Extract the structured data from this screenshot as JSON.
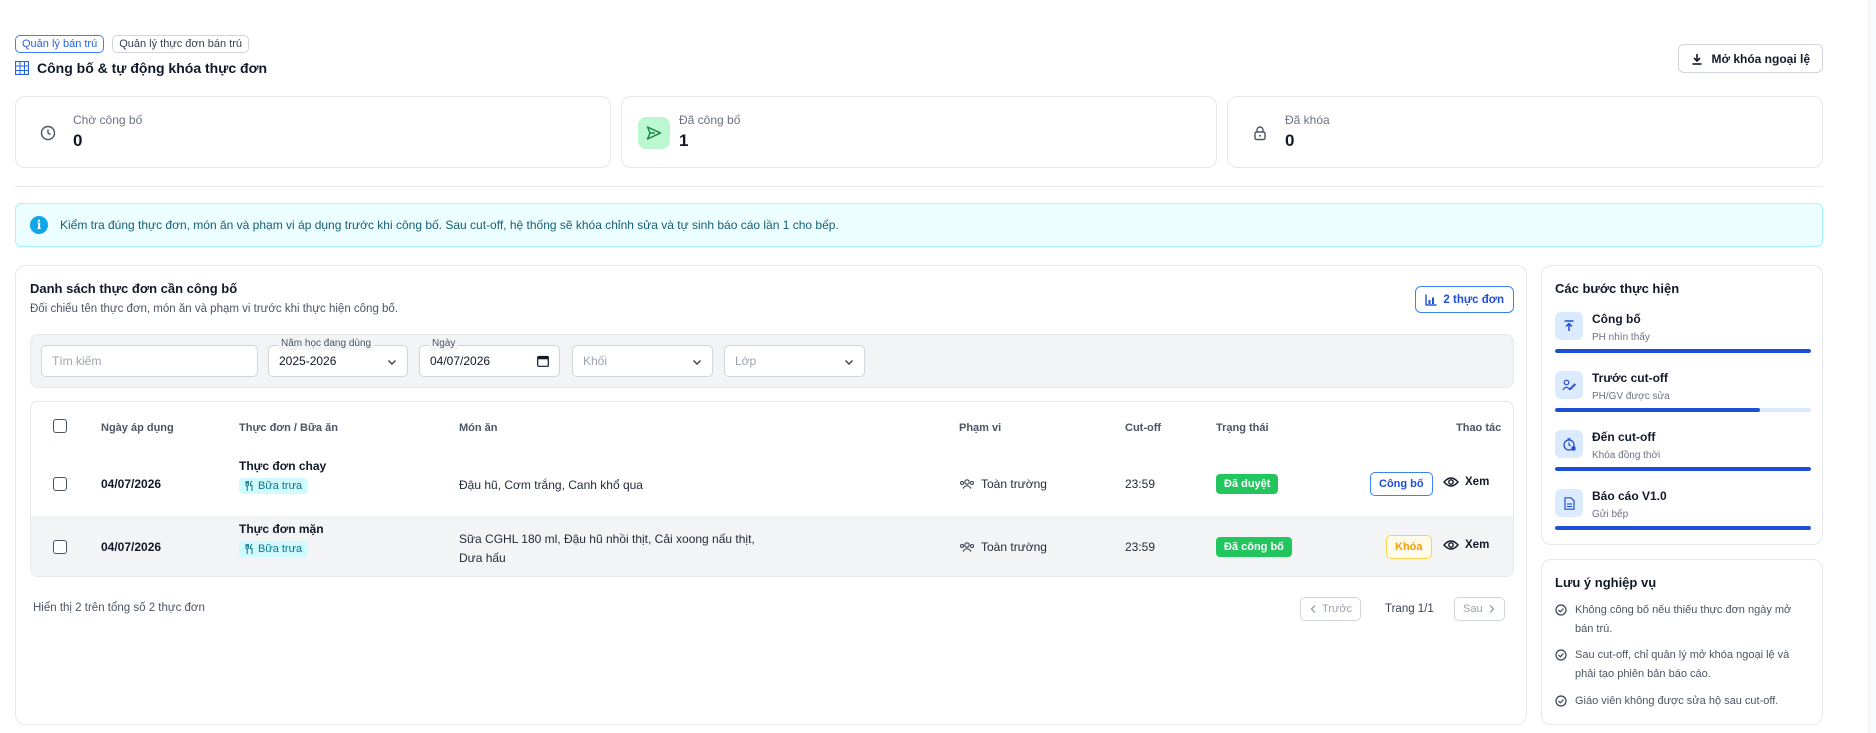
{
  "breadcrumbs": [
    {
      "label": "Quản lý bán trú"
    },
    {
      "label": "Quản lý thực đơn bán trú"
    }
  ],
  "page_title": "Công bố & tự động khóa thực đơn",
  "unlock_button": "Mở khóa ngoại lệ",
  "stats": [
    {
      "label": "Chờ công bố",
      "value": "0",
      "icon": "clock-icon"
    },
    {
      "label": "Đã công bố",
      "value": "1",
      "icon": "send-icon"
    },
    {
      "label": "Đã khóa",
      "value": "0",
      "icon": "lock-icon"
    }
  ],
  "info_banner": "Kiểm tra đúng thực đơn, món ăn và phạm vi áp dụng trước khi công bố. Sau cut-off, hệ thống sẽ khóa chỉnh sửa và tự sinh báo cáo lần 1 cho bếp.",
  "list": {
    "title": "Danh sách thực đơn cần công bố",
    "subtitle": "Đối chiếu tên thực đơn, món ăn và phạm vi trước khi thực hiện công bố.",
    "count_badge": "2 thực đơn"
  },
  "filters": {
    "search_placeholder": "Tìm kiếm",
    "year_label": "Năm học đang dùng",
    "year_value": "2025-2026",
    "date_label": "Ngày",
    "date_value": "04/07/2026",
    "grade_placeholder": "Khối",
    "class_placeholder": "Lớp"
  },
  "table": {
    "headers": {
      "date": "Ngày áp dụng",
      "menu": "Thực đơn / Bữa ăn",
      "dishes": "Món ăn",
      "scope": "Phạm vi",
      "cutoff": "Cut-off",
      "status": "Trạng thái",
      "actions": "Thao tác"
    },
    "rows": [
      {
        "date": "04/07/2026",
        "menu": "Thực đơn chay",
        "meal": "Bữa trưa",
        "dishes_line1": "Đậu hũ, Cơm trắng, Canh khổ qua",
        "dishes_line2": "",
        "scope": "Toàn trường",
        "cutoff": "23:59",
        "status": "Đã duyệt",
        "action": "Công bố",
        "view": "Xem"
      },
      {
        "date": "04/07/2026",
        "menu": "Thực đơn mặn",
        "meal": "Bữa trưa",
        "dishes_line1": "Sữa CGHL 180 ml, Đậu hũ nhồi thịt, Cải xoong nấu thịt,",
        "dishes_line2": "Dưa hấu",
        "scope": "Toàn trường",
        "cutoff": "23:59",
        "status": "Đã công bố",
        "action": "Khóa",
        "view": "Xem"
      }
    ]
  },
  "pagination": {
    "summary": "Hiển thị 2 trên tổng số 2 thực đơn",
    "prev": "Trước",
    "page": "Trang 1/1",
    "next": "Sau"
  },
  "steps": {
    "title": "Các bước thực hiện",
    "items": [
      {
        "title": "Công bố",
        "subtitle": "PH nhìn thấy",
        "progress": 1.0,
        "icon": "upload-icon"
      },
      {
        "title": "Trước cut-off",
        "subtitle": "PH/GV được sửa",
        "progress": 0.8,
        "icon": "user-edit-icon"
      },
      {
        "title": "Đến cut-off",
        "subtitle": "Khóa đồng thời",
        "progress": 1.0,
        "icon": "timer-lock-icon"
      },
      {
        "title": "Báo cáo V1.0",
        "subtitle": "Gửi bếp",
        "progress": 1.0,
        "icon": "report-icon"
      }
    ]
  },
  "notes": {
    "title": "Lưu ý nghiệp vụ",
    "items": [
      {
        "line1": "Không công bố nếu thiếu thực đơn ngày mở",
        "line2": "bán trú."
      },
      {
        "line1": "Sau cut-off, chỉ quản lý mở khóa ngoại lệ và",
        "line2": "phải tạo phiên bản báo cáo."
      },
      {
        "line1": "Giáo viên không được sửa hộ sau cut-off.",
        "line2": ""
      }
    ]
  },
  "colors": {
    "primary": "#1d4ed8",
    "success": "#22c55e",
    "warning": "#f59e0b",
    "info_bg": "#ecfeff"
  }
}
